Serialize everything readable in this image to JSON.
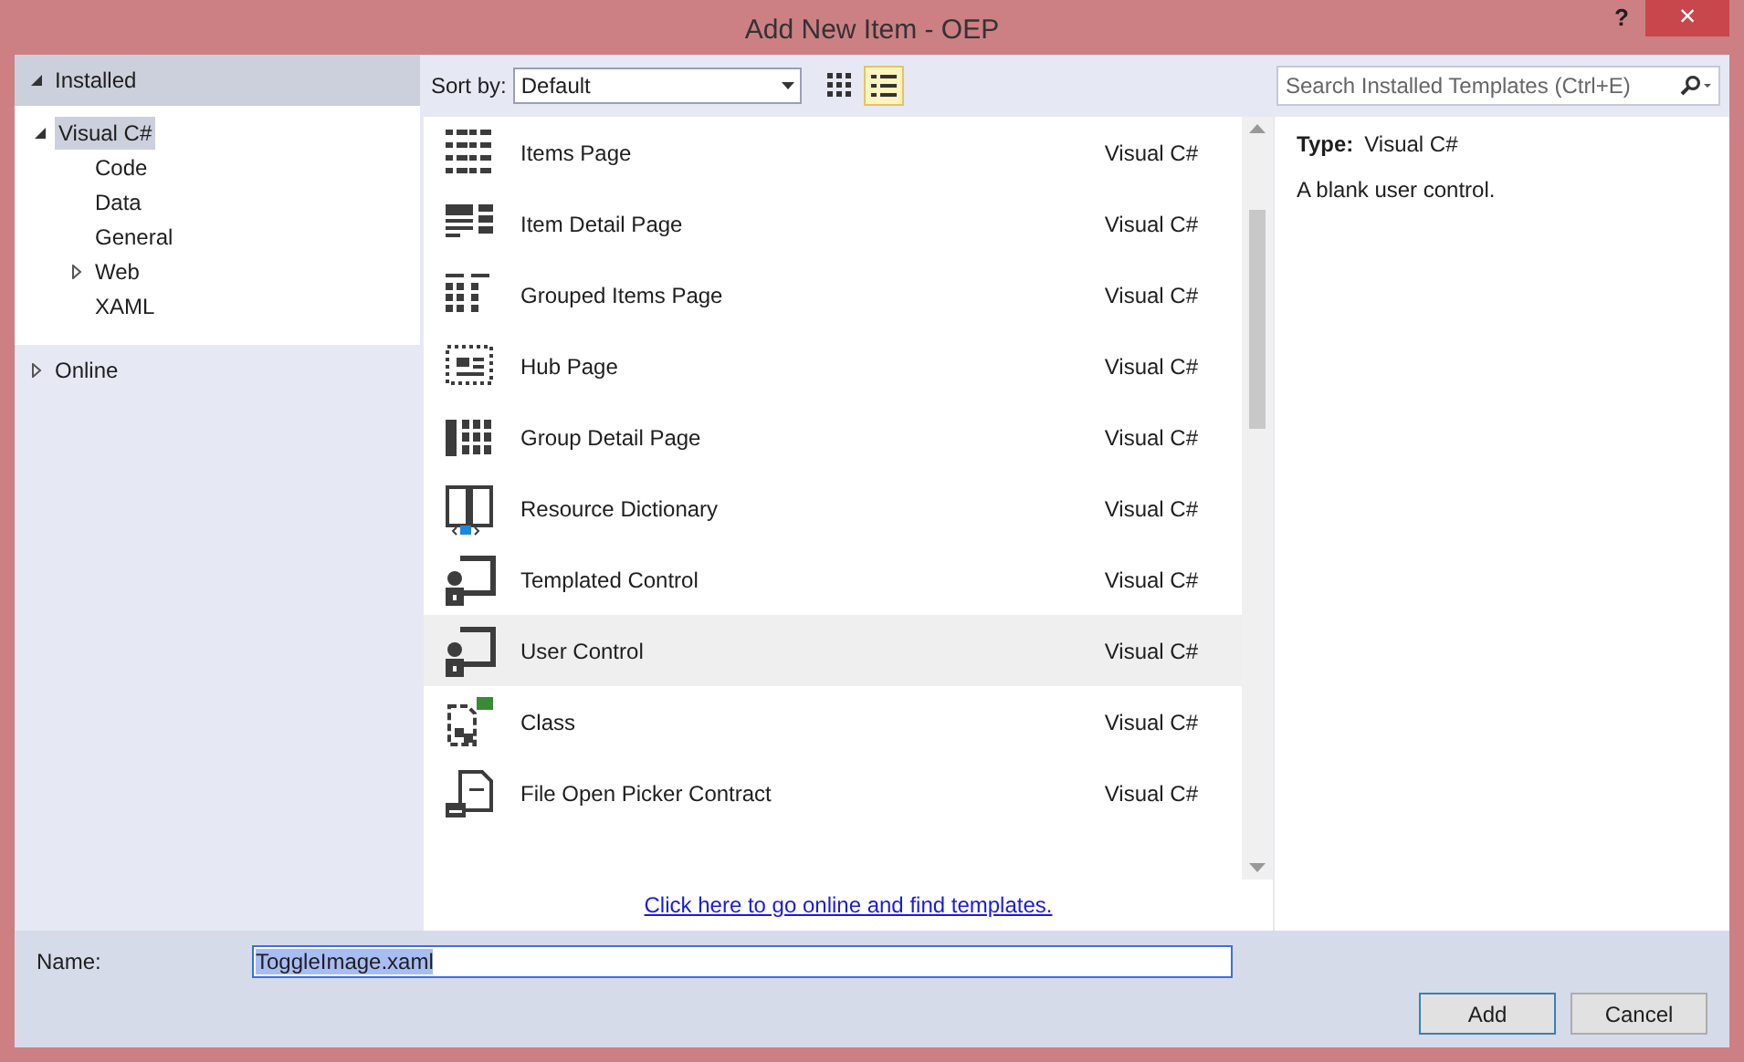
{
  "window": {
    "title": "Add New Item - OEP",
    "help": "?",
    "close": "×"
  },
  "sidebar": {
    "sections": [
      {
        "label": "Installed",
        "expanded": true,
        "selected": true,
        "children": [
          {
            "label": "Visual C#",
            "expanded": true,
            "selected": true,
            "children": [
              {
                "label": "Code"
              },
              {
                "label": "Data"
              },
              {
                "label": "General"
              },
              {
                "label": "Web",
                "expandable": true
              },
              {
                "label": "XAML"
              }
            ]
          }
        ]
      },
      {
        "label": "Online",
        "expanded": false,
        "selected": false
      }
    ]
  },
  "toolbar": {
    "sort_label": "Sort by:",
    "sort_value": "Default",
    "views": [
      {
        "kind": "grid",
        "selected": false
      },
      {
        "kind": "list",
        "selected": true
      }
    ]
  },
  "search": {
    "placeholder": "Search Installed Templates (Ctrl+E)"
  },
  "templates": [
    {
      "name": "Items Page",
      "language": "Visual C#",
      "kind": "items",
      "selected": false
    },
    {
      "name": "Item Detail Page",
      "language": "Visual C#",
      "kind": "detail",
      "selected": false
    },
    {
      "name": "Grouped Items Page",
      "language": "Visual C#",
      "kind": "grouped",
      "selected": false
    },
    {
      "name": "Hub Page",
      "language": "Visual C#",
      "kind": "hub",
      "selected": false
    },
    {
      "name": "Group Detail Page",
      "language": "Visual C#",
      "kind": "groupdetail",
      "selected": false
    },
    {
      "name": "Resource Dictionary",
      "language": "Visual C#",
      "kind": "dictionary",
      "selected": false
    },
    {
      "name": "Templated Control",
      "language": "Visual C#",
      "kind": "control",
      "selected": false
    },
    {
      "name": "User Control",
      "language": "Visual C#",
      "kind": "control",
      "selected": true
    },
    {
      "name": "Class",
      "language": "Visual C#",
      "kind": "class",
      "selected": false
    },
    {
      "name": "File Open Picker Contract",
      "language": "Visual C#",
      "kind": "picker",
      "selected": false
    }
  ],
  "online_link": "Click here to go online and find templates.",
  "details": {
    "type_label": "Type:",
    "type_value": "Visual C#",
    "description": "A blank user control."
  },
  "name_field": {
    "label": "Name:",
    "value": "ToggleImage.xaml"
  },
  "buttons": [
    {
      "label": "Add",
      "default": true
    },
    {
      "label": "Cancel",
      "default": false
    }
  ]
}
